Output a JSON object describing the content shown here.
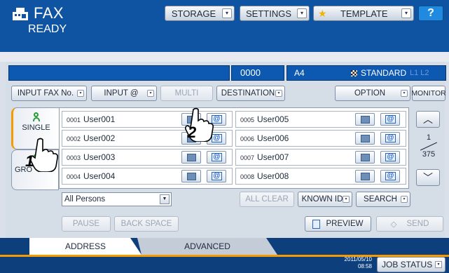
{
  "header": {
    "title": "FAX",
    "status": "READY",
    "buttons": [
      {
        "label": "STORAGE"
      },
      {
        "label": "SETTINGS"
      },
      {
        "label": "TEMPLATE"
      }
    ],
    "help_label": "?"
  },
  "display": {
    "count": "0000",
    "paper_size": "A4",
    "quality": "STANDARD",
    "line_indicator": "L1  L2"
  },
  "toolbar": {
    "input_fax_no": "INPUT FAX No.",
    "input_at": "INPUT @",
    "multi": "MULTI",
    "destination": "DESTINATION",
    "option": "OPTION",
    "monitor": "MONITOR"
  },
  "tabs": {
    "single": "SINGLE",
    "group": "GRO"
  },
  "entries": [
    {
      "num": "0001",
      "name": "User001"
    },
    {
      "num": "0002",
      "name": "User002"
    },
    {
      "num": "0003",
      "name": "User003"
    },
    {
      "num": "0004",
      "name": "User004"
    },
    {
      "num": "0005",
      "name": "User005"
    },
    {
      "num": "0006",
      "name": "User006"
    },
    {
      "num": "0007",
      "name": "User007"
    },
    {
      "num": "0008",
      "name": "User008"
    }
  ],
  "pager": {
    "current": "1",
    "total": "375"
  },
  "filter": {
    "value": "All Persons"
  },
  "actions": {
    "all_clear": "ALL CLEAR",
    "known_id": "KNOWN ID",
    "search": "SEARCH",
    "pause": "PAUSE",
    "back_space": "BACK SPACE",
    "preview": "PREVIEW",
    "send": "SEND"
  },
  "bottom_tabs": {
    "address": "ADDRESS",
    "advanced": "ADVANCED"
  },
  "footer": {
    "date": "2011/05/10",
    "time": "08:58",
    "job_status": "JOB STATUS"
  },
  "markers": {
    "one": "1",
    "two": "2"
  },
  "colors": {
    "header_blue": "#0f53a3",
    "display_blue": "#0d58b1",
    "accent_orange": "#f59a00"
  }
}
